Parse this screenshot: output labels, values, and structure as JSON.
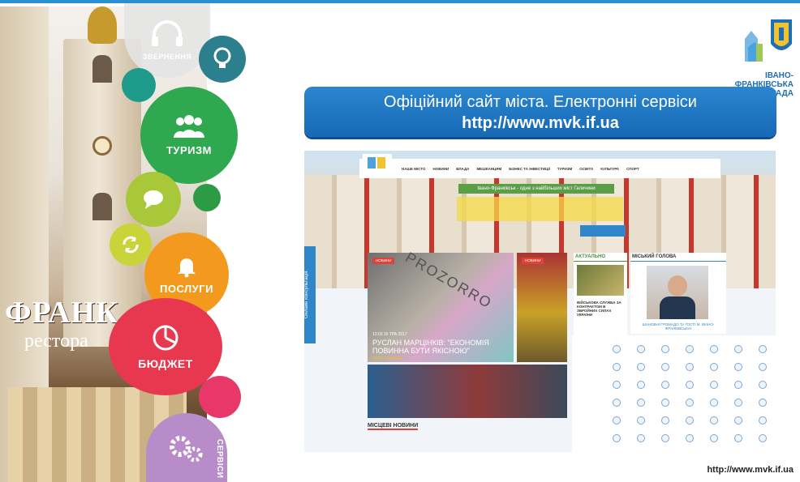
{
  "slide": {
    "title_line1": "Офіційний сайт міста. Електронні сервіси",
    "title_line2": "http://www.mvk.if.ua",
    "footer_url": "http://www.mvk.if.ua",
    "org_line1": "ІВАНО-ФРАНКІВСЬКА",
    "org_line2": "МІСЬКА РАДА",
    "accent_color": "#1f6fb5"
  },
  "photo": {
    "sign_text": "ФРАНК",
    "sign_sub": "рестора"
  },
  "circles": [
    {
      "label": "ЗВЕРНЕННЯ",
      "icon": "headset-icon",
      "color": "#e4e4e4"
    },
    {
      "label": "",
      "icon": "lightbulb-icon",
      "color": "#2c7f8c"
    },
    {
      "label": "",
      "icon": "",
      "color": "#1e9b8a"
    },
    {
      "label": "ТУРИЗМ",
      "icon": "people-icon",
      "color": "#2fa84f"
    },
    {
      "label": "",
      "icon": "chat-bubble-icon",
      "color": "#a8c83a"
    },
    {
      "label": "",
      "icon": "",
      "color": "#2d9b45"
    },
    {
      "label": "",
      "icon": "refresh-icon",
      "color": "#c8d43a"
    },
    {
      "label": "ПОСЛУГИ",
      "icon": "bell-icon",
      "color": "#f39a1e"
    },
    {
      "label": "БЮДЖЕТ",
      "icon": "pie-chart-icon",
      "color": "#e8384f"
    },
    {
      "label": "",
      "icon": "",
      "color": "#e8386a"
    },
    {
      "label": "СЕРВІСИ",
      "icon": "gears-icon",
      "color": "#b78cc9"
    }
  ],
  "site": {
    "nav": [
      "НАШЕ МІСТО",
      "НОВИНИ",
      "ВЛАДА",
      "МЕШКАНЦЯМ",
      "БІЗНЕС ТА ІНВЕСТИЦІЇ",
      "ТУРИЗМ",
      "ОСВІТА",
      "КУЛЬТУРА",
      "СПОРТ"
    ],
    "slogan": "Івано-Франківськ - одне з найбільших міст Галичини",
    "vertical_tab": "Онлайн консультація",
    "badge_news": "НОВИНИ",
    "prozorro": "PROZORRO",
    "date": "12:03 16 ТРА 2017",
    "headline": "РУСЛАН МАРЦІНКІВ: \"ЕКОНОМІЯ ПОВИННА БУТИ ЯКІСНОЮ\"",
    "headline_tag": "ПРЕС-СЛУЖБА",
    "actual_head": "АКТУАЛЬНО",
    "actual_text": "ВІЙСЬКОВА СЛУЖБА ЗА КОНТРАКТОМ В ЗБРОЙНИХ СИЛАХ УКРАЇНИ",
    "mayor_head": "МІСЬКИЙ ГОЛОВА",
    "mayor_caption": "ШАНОВНІ ГРОМАДО ТА ГОСТІ М. ІВАНО-ФРАНКІВСЬКА!",
    "misc_news": "МІСЦЕВІ НОВИНИ"
  }
}
